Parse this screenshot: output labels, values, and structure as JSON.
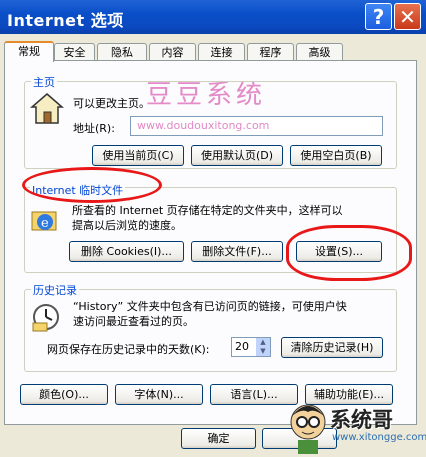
{
  "window": {
    "title": "Internet 选项",
    "help_label": "?",
    "close_label": "✕"
  },
  "tabs": [
    "常规",
    "安全",
    "隐私",
    "内容",
    "连接",
    "程序",
    "高级"
  ],
  "watermark": "豆豆系统",
  "home": {
    "group_label": "主页",
    "desc": "可以更改主页。",
    "address_label": "地址(R):",
    "address_value": "www.doudouxitong.com",
    "btn_current": "使用当前页(C)",
    "btn_default": "使用默认页(D)",
    "btn_blank": "使用空白页(B)"
  },
  "temp": {
    "group_label": "Internet 临时文件",
    "desc_line1": "所查看的 Internet 页存储在特定的文件夹中，这样可以",
    "desc_line2": "提高以后浏览的速度。",
    "btn_cookies": "删除 Cookies(I)...",
    "btn_files": "删除文件(F)...",
    "btn_settings": "设置(S)..."
  },
  "history": {
    "group_label": "历史记录",
    "desc_line1": "“History” 文件夹中包含有已访问页的链接，可使用户快",
    "desc_line2": "速访问最近查看过的页。",
    "days_label": "网页保存在历史记录中的天数(K):",
    "days_value": "20",
    "btn_clear": "清除历史记录(H)"
  },
  "bottom_buttons": {
    "colors": "颜色(O)...",
    "fonts": "字体(N)...",
    "languages": "语言(L)...",
    "accessibility": "辅助功能(E)..."
  },
  "dialog": {
    "ok": "确定"
  },
  "logo": {
    "name": "系统哥",
    "url": "www.xitongge.com"
  }
}
